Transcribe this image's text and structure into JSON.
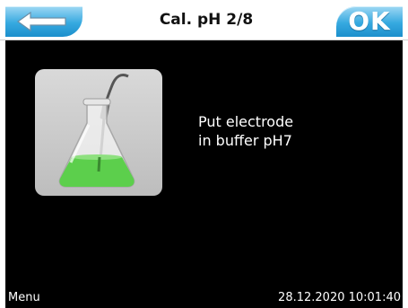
{
  "header": {
    "title": "Cal. pH 2/8",
    "back_icon": "arrow-left-icon",
    "ok_label": "OK",
    "accent_color": "#36a9e0"
  },
  "main": {
    "illustration_icon": "electrode-in-flask-icon",
    "instruction_line1": "Put electrode",
    "instruction_line2": "in buffer pH7"
  },
  "footer": {
    "menu_label": "Menu",
    "datetime": "28.12.2020 10:01:40"
  }
}
